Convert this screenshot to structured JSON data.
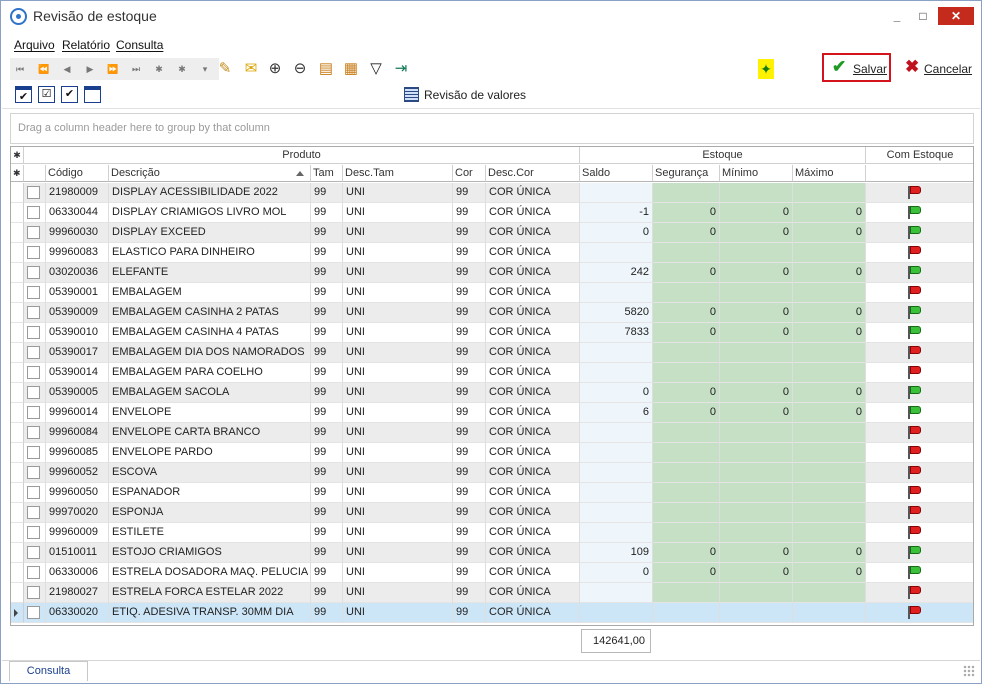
{
  "window": {
    "title": "Revisão de estoque",
    "controls": [
      "_",
      "□",
      "✕"
    ]
  },
  "menu": [
    {
      "label": "Arquivo"
    },
    {
      "label": "Relatório"
    },
    {
      "label": "Consulta"
    }
  ],
  "nav_glyphs": [
    "⏮",
    "⏪",
    "◀",
    "▶",
    "⏩",
    "⏭",
    "✱",
    "✱",
    "▾"
  ],
  "tool_icons": [
    {
      "name": "edit-note-icon",
      "glyph": "✎"
    },
    {
      "name": "email-icon",
      "glyph": "✉"
    },
    {
      "name": "zoom-in-icon",
      "glyph": "⊕"
    },
    {
      "name": "zoom-out-icon",
      "glyph": "⊖"
    },
    {
      "name": "table-icon",
      "glyph": "▤"
    },
    {
      "name": "layout-icon",
      "glyph": "▦"
    },
    {
      "name": "filter-icon",
      "glyph": "▽"
    },
    {
      "name": "door-exit-icon",
      "glyph": "⇥"
    }
  ],
  "actions": {
    "save_label": "Salvar",
    "cancel_label": "Cancelar",
    "revisao_label": "Revisão de valores"
  },
  "group_panel_text": "Drag a column header here to group by that column",
  "grid": {
    "bands": {
      "produto": "Produto",
      "estoque": "Estoque",
      "com_estoque": "Com Estoque"
    },
    "columns": {
      "codigo": "Código",
      "descricao": "Descrição",
      "tam": "Tam",
      "desc_tam": "Desc.Tam",
      "cor": "Cor",
      "desc_cor": "Desc.Cor",
      "saldo": "Saldo",
      "seguranca": "Segurança",
      "minimo": "Mínimo",
      "maximo": "Máximo"
    },
    "rows": [
      {
        "codigo": "21980009",
        "descricao": "DISPLAY ACESSIBILIDADE 2022",
        "tam": "99",
        "desc_tam": "UNI",
        "cor": "99",
        "desc_cor": "COR ÚNICA",
        "saldo": "",
        "seguranca": "",
        "minimo": "",
        "maximo": "",
        "flag": "red"
      },
      {
        "codigo": "06330044",
        "descricao": "DISPLAY CRIAMIGOS LIVRO MOL",
        "tam": "99",
        "desc_tam": "UNI",
        "cor": "99",
        "desc_cor": "COR ÚNICA",
        "saldo": "-1",
        "seguranca": "0",
        "minimo": "0",
        "maximo": "0",
        "flag": "green"
      },
      {
        "codigo": "99960030",
        "descricao": "DISPLAY EXCEED",
        "tam": "99",
        "desc_tam": "UNI",
        "cor": "99",
        "desc_cor": "COR ÚNICA",
        "saldo": "0",
        "seguranca": "0",
        "minimo": "0",
        "maximo": "0",
        "flag": "green"
      },
      {
        "codigo": "99960083",
        "descricao": "ELASTICO PARA DINHEIRO",
        "tam": "99",
        "desc_tam": "UNI",
        "cor": "99",
        "desc_cor": "COR ÚNICA",
        "saldo": "",
        "seguranca": "",
        "minimo": "",
        "maximo": "",
        "flag": "red"
      },
      {
        "codigo": "03020036",
        "descricao": "ELEFANTE",
        "tam": "99",
        "desc_tam": "UNI",
        "cor": "99",
        "desc_cor": "COR ÚNICA",
        "saldo": "242",
        "seguranca": "0",
        "minimo": "0",
        "maximo": "0",
        "flag": "green"
      },
      {
        "codigo": "05390001",
        "descricao": "EMBALAGEM",
        "tam": "99",
        "desc_tam": "UNI",
        "cor": "99",
        "desc_cor": "COR ÚNICA",
        "saldo": "",
        "seguranca": "",
        "minimo": "",
        "maximo": "",
        "flag": "red"
      },
      {
        "codigo": "05390009",
        "descricao": "EMBALAGEM CASINHA 2 PATAS",
        "tam": "99",
        "desc_tam": "UNI",
        "cor": "99",
        "desc_cor": "COR ÚNICA",
        "saldo": "5820",
        "seguranca": "0",
        "minimo": "0",
        "maximo": "0",
        "flag": "green"
      },
      {
        "codigo": "05390010",
        "descricao": "EMBALAGEM CASINHA 4 PATAS",
        "tam": "99",
        "desc_tam": "UNI",
        "cor": "99",
        "desc_cor": "COR ÚNICA",
        "saldo": "7833",
        "seguranca": "0",
        "minimo": "0",
        "maximo": "0",
        "flag": "green"
      },
      {
        "codigo": "05390017",
        "descricao": "EMBALAGEM DIA DOS NAMORADOS",
        "tam": "99",
        "desc_tam": "UNI",
        "cor": "99",
        "desc_cor": "COR ÚNICA",
        "saldo": "",
        "seguranca": "",
        "minimo": "",
        "maximo": "",
        "flag": "red"
      },
      {
        "codigo": "05390014",
        "descricao": "EMBALAGEM PARA COELHO",
        "tam": "99",
        "desc_tam": "UNI",
        "cor": "99",
        "desc_cor": "COR ÚNICA",
        "saldo": "",
        "seguranca": "",
        "minimo": "",
        "maximo": "",
        "flag": "red"
      },
      {
        "codigo": "05390005",
        "descricao": "EMBALAGEM SACOLA",
        "tam": "99",
        "desc_tam": "UNI",
        "cor": "99",
        "desc_cor": "COR ÚNICA",
        "saldo": "0",
        "seguranca": "0",
        "minimo": "0",
        "maximo": "0",
        "flag": "green"
      },
      {
        "codigo": "99960014",
        "descricao": "ENVELOPE",
        "tam": "99",
        "desc_tam": "UNI",
        "cor": "99",
        "desc_cor": "COR ÚNICA",
        "saldo": "6",
        "seguranca": "0",
        "minimo": "0",
        "maximo": "0",
        "flag": "green"
      },
      {
        "codigo": "99960084",
        "descricao": "ENVELOPE CARTA BRANCO",
        "tam": "99",
        "desc_tam": "UNI",
        "cor": "99",
        "desc_cor": "COR ÚNICA",
        "saldo": "",
        "seguranca": "",
        "minimo": "",
        "maximo": "",
        "flag": "red"
      },
      {
        "codigo": "99960085",
        "descricao": "ENVELOPE PARDO",
        "tam": "99",
        "desc_tam": "UNI",
        "cor": "99",
        "desc_cor": "COR ÚNICA",
        "saldo": "",
        "seguranca": "",
        "minimo": "",
        "maximo": "",
        "flag": "red"
      },
      {
        "codigo": "99960052",
        "descricao": "ESCOVA",
        "tam": "99",
        "desc_tam": "UNI",
        "cor": "99",
        "desc_cor": "COR ÚNICA",
        "saldo": "",
        "seguranca": "",
        "minimo": "",
        "maximo": "",
        "flag": "red"
      },
      {
        "codigo": "99960050",
        "descricao": "ESPANADOR",
        "tam": "99",
        "desc_tam": "UNI",
        "cor": "99",
        "desc_cor": "COR ÚNICA",
        "saldo": "",
        "seguranca": "",
        "minimo": "",
        "maximo": "",
        "flag": "red"
      },
      {
        "codigo": "99970020",
        "descricao": "ESPONJA",
        "tam": "99",
        "desc_tam": "UNI",
        "cor": "99",
        "desc_cor": "COR ÚNICA",
        "saldo": "",
        "seguranca": "",
        "minimo": "",
        "maximo": "",
        "flag": "red"
      },
      {
        "codigo": "99960009",
        "descricao": "ESTILETE",
        "tam": "99",
        "desc_tam": "UNI",
        "cor": "99",
        "desc_cor": "COR ÚNICA",
        "saldo": "",
        "seguranca": "",
        "minimo": "",
        "maximo": "",
        "flag": "red"
      },
      {
        "codigo": "01510011",
        "descricao": "ESTOJO CRIAMIGOS",
        "tam": "99",
        "desc_tam": "UNI",
        "cor": "99",
        "desc_cor": "COR ÚNICA",
        "saldo": "109",
        "seguranca": "0",
        "minimo": "0",
        "maximo": "0",
        "flag": "green"
      },
      {
        "codigo": "06330006",
        "descricao": "ESTRELA DOSADORA MAQ. PELUCIA",
        "tam": "99",
        "desc_tam": "UNI",
        "cor": "99",
        "desc_cor": "COR ÚNICA",
        "saldo": "0",
        "seguranca": "0",
        "minimo": "0",
        "maximo": "0",
        "flag": "green"
      },
      {
        "codigo": "21980027",
        "descricao": "ESTRELA FORCA ESTELAR 2022",
        "tam": "99",
        "desc_tam": "UNI",
        "cor": "99",
        "desc_cor": "COR ÚNICA",
        "saldo": "",
        "seguranca": "",
        "minimo": "",
        "maximo": "",
        "flag": "red"
      },
      {
        "codigo": "06330020",
        "descricao": "ETIQ. ADESIVA TRANSP. 30MM DIA",
        "tam": "99",
        "desc_tam": "UNI",
        "cor": "99",
        "desc_cor": "COR ÚNICA",
        "saldo": "",
        "seguranca": "",
        "minimo": "",
        "maximo": "",
        "flag": "red",
        "selected": true
      }
    ],
    "total_saldo": "142641,00"
  },
  "status_tab": "Consulta",
  "colors": {
    "accent": "#2f74c8",
    "save_border": "#d3141c",
    "green_cells": "#c5e0c4",
    "selected_row": "#cde6f7",
    "flag_red": "#e02020",
    "flag_green": "#3cc03c"
  }
}
